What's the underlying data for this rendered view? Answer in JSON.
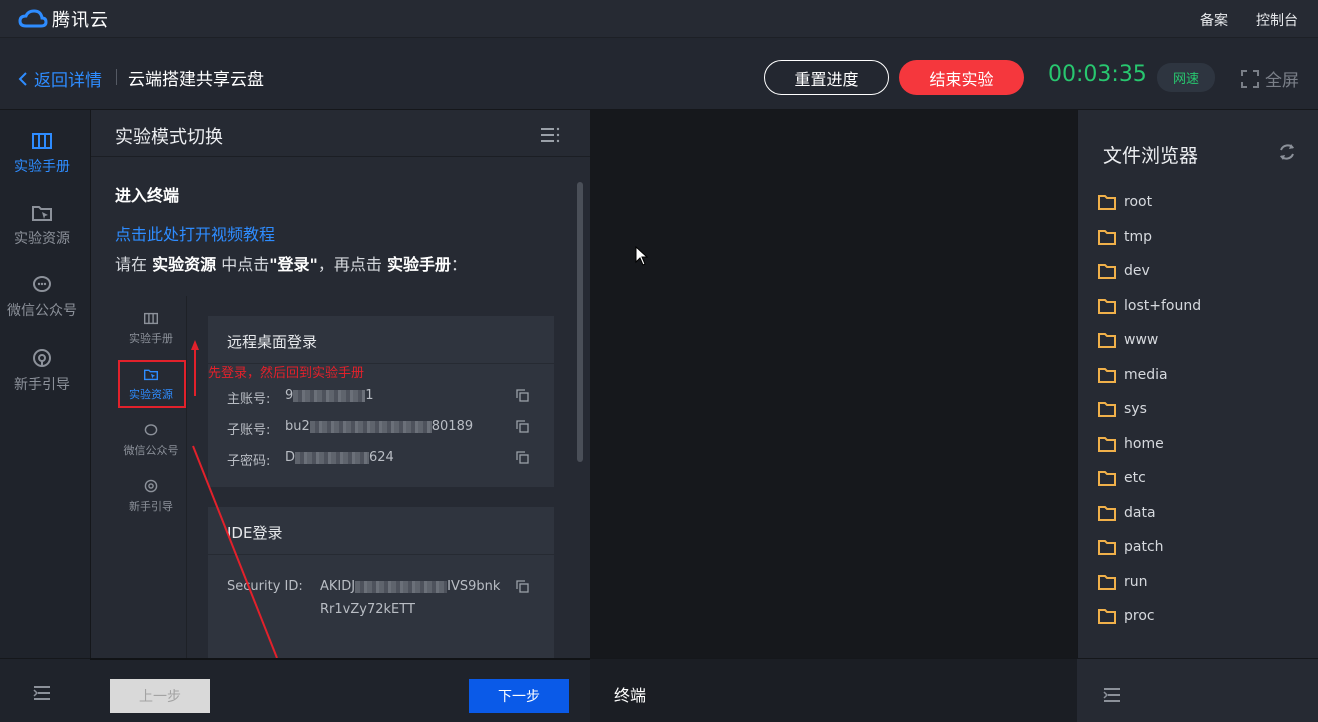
{
  "topbar": {
    "logo_text": "腾讯云",
    "links": [
      "备案",
      "控制台"
    ]
  },
  "header": {
    "back_label": "返回详情",
    "lab_title": "云端搭建共享云盘",
    "reset_label": "重置进度",
    "end_label": "结束实验",
    "timer": "00:03:35",
    "net_badge": "网速",
    "fullscreen_label": "全屏"
  },
  "leftnav": {
    "items": [
      {
        "label": "实验手册",
        "icon": "book-icon",
        "active": true
      },
      {
        "label": "实验资源",
        "icon": "folder-cursor-icon",
        "active": false
      },
      {
        "label": "微信公众号",
        "icon": "chat-bubble-icon",
        "active": false
      },
      {
        "label": "新手引导",
        "icon": "guide-icon",
        "active": false
      }
    ]
  },
  "manual": {
    "title": "实验模式切换",
    "section_title": "进入终端",
    "video_link": "点击此处打开视频教程",
    "instr_parts": [
      "请在 ",
      "实验资源",
      " 中点击",
      "\"登录\"",
      "，再点击 ",
      "实验手册",
      "："
    ],
    "embed": {
      "nav_items": [
        "实验手册",
        "实验资源",
        "微信公众号",
        "新手引导"
      ],
      "note": "先登录，然后回到实验手册",
      "card1": {
        "title": "远程桌面登录",
        "rows": [
          {
            "label": "主账号:",
            "prefix": "9",
            "suffix": "1"
          },
          {
            "label": "子账号:",
            "prefix": "bu2",
            "suffix": "80189"
          },
          {
            "label": "子密码:",
            "prefix": "D",
            "suffix": "624"
          }
        ]
      },
      "card2": {
        "title": "IDE登录",
        "label": "Security ID:",
        "prefix": "AKIDJ",
        "suffix": "IVS9bnk",
        "line2": "Rr1vZy72kETT"
      }
    }
  },
  "footer": {
    "prev_label": "上一步",
    "next_label": "下一步",
    "terminal_label": "终端"
  },
  "filebrowser": {
    "title": "文件浏览器",
    "items": [
      "root",
      "tmp",
      "dev",
      "lost+found",
      "www",
      "media",
      "sys",
      "home",
      "etc",
      "data",
      "patch",
      "run",
      "proc"
    ]
  },
  "colors": {
    "accent_blue": "#2e8cff",
    "danger_red": "#f5373d",
    "timer_green": "#28c76f",
    "folder_orange": "#f0b04a"
  }
}
